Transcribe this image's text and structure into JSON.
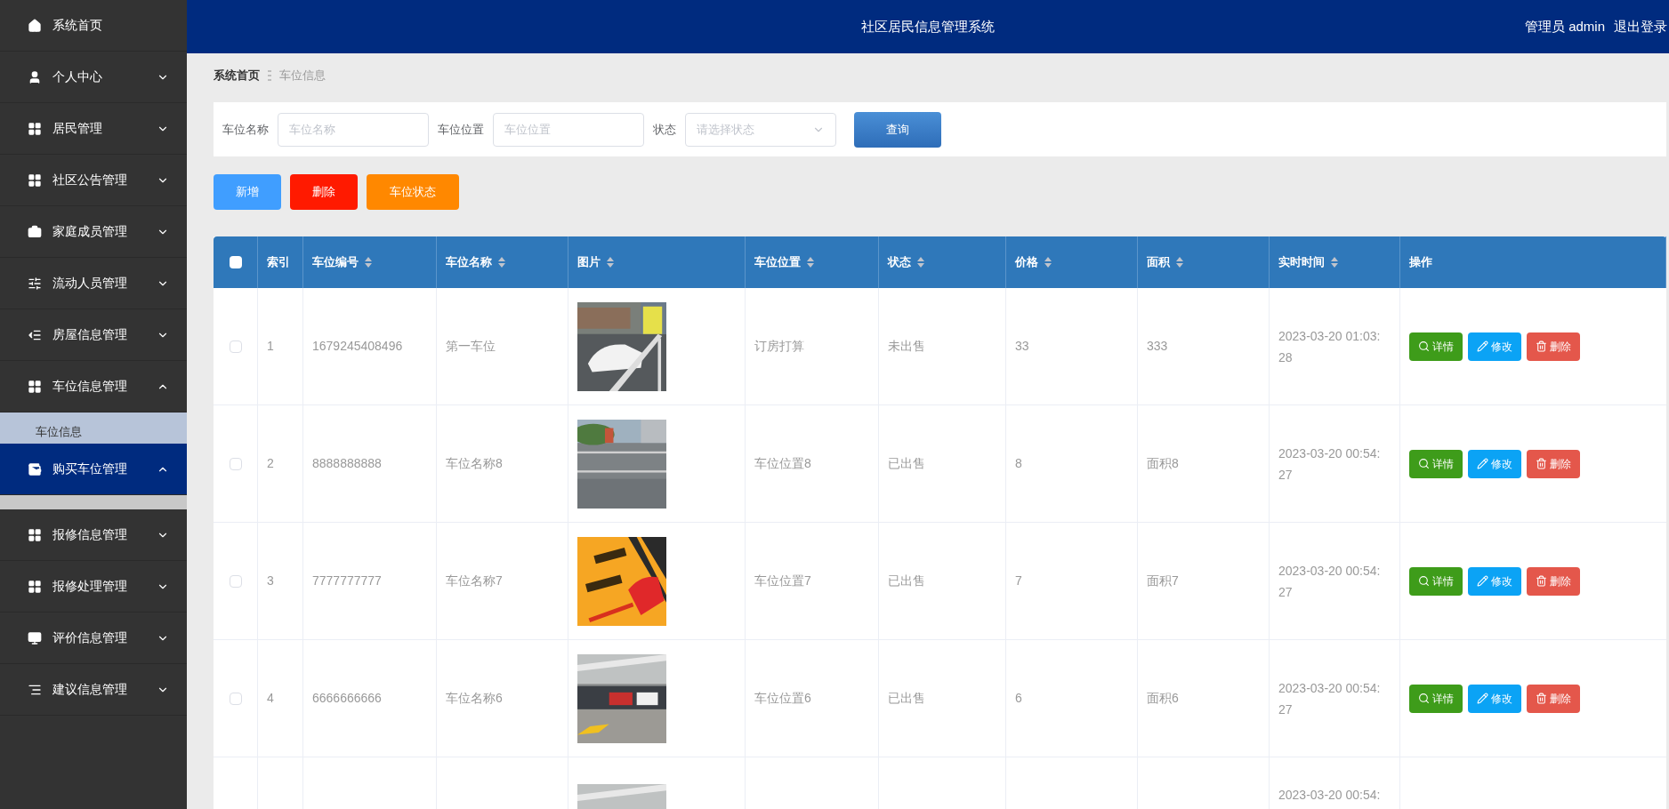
{
  "header": {
    "title": "社区居民信息管理系统",
    "user": "管理员 admin",
    "logout": "退出登录"
  },
  "sidebar": {
    "items": [
      {
        "label": "系统首页",
        "expandable": false,
        "selected": false
      },
      {
        "label": "个人中心",
        "expandable": true,
        "expanded": false,
        "selected": false
      },
      {
        "label": "居民管理",
        "expandable": true,
        "expanded": false,
        "selected": false
      },
      {
        "label": "社区公告管理",
        "expandable": true,
        "expanded": false,
        "selected": false
      },
      {
        "label": "家庭成员管理",
        "expandable": true,
        "expanded": false,
        "selected": false
      },
      {
        "label": "流动人员管理",
        "expandable": true,
        "expanded": false,
        "selected": false
      },
      {
        "label": "房屋信息管理",
        "expandable": true,
        "expanded": false,
        "selected": false
      },
      {
        "label": "车位信息管理",
        "expandable": true,
        "expanded": true,
        "selected": false,
        "children": [
          {
            "label": "车位信息"
          }
        ]
      },
      {
        "label": "购买车位管理",
        "expandable": true,
        "expanded": true,
        "selected": true
      },
      {
        "label": "报修信息管理",
        "expandable": true,
        "expanded": false,
        "selected": false
      },
      {
        "label": "报修处理管理",
        "expandable": true,
        "expanded": false,
        "selected": false
      },
      {
        "label": "评价信息管理",
        "expandable": true,
        "expanded": false,
        "selected": false
      },
      {
        "label": "建议信息管理",
        "expandable": true,
        "expanded": false,
        "selected": false
      }
    ]
  },
  "breadcrumb": [
    "系统首页",
    "车位信息"
  ],
  "search": {
    "fields": [
      {
        "label": "车位名称",
        "placeholder": "车位名称",
        "kind": "input"
      },
      {
        "label": "车位位置",
        "placeholder": "车位位置",
        "kind": "input"
      },
      {
        "label": "状态",
        "placeholder": "请选择状态",
        "kind": "select"
      }
    ],
    "button": "查询"
  },
  "toolbar": [
    {
      "label": "新增",
      "kind": "add"
    },
    {
      "label": "删除",
      "kind": "delete"
    },
    {
      "label": "车位状态",
      "kind": "status"
    }
  ],
  "table": {
    "all_checked": false,
    "columns": [
      {
        "label": "索引",
        "sortable": false
      },
      {
        "label": "车位编号",
        "sortable": true
      },
      {
        "label": "车位名称",
        "sortable": true
      },
      {
        "label": "图片",
        "sortable": true
      },
      {
        "label": "车位位置",
        "sortable": true
      },
      {
        "label": "状态",
        "sortable": true
      },
      {
        "label": "价格",
        "sortable": true
      },
      {
        "label": "面积",
        "sortable": true
      },
      {
        "label": "实时时间",
        "sortable": true
      },
      {
        "label": "操作",
        "sortable": false
      }
    ],
    "rows": [
      {
        "checked": false,
        "index": "1",
        "number": "1679245408496",
        "name": "第一车位",
        "location": "订房打算",
        "status": "未出售",
        "price": "33",
        "area": "333",
        "time": "2023-03-20 01:03:28",
        "actions": [
          {
            "label": "详情",
            "kind": "detail"
          },
          {
            "label": "修改",
            "kind": "edit"
          },
          {
            "label": "删除",
            "kind": "delete"
          }
        ]
      },
      {
        "checked": false,
        "index": "2",
        "number": "8888888888",
        "name": "车位名称8",
        "location": "车位位置8",
        "status": "已出售",
        "price": "8",
        "area": "面积8",
        "time": "2023-03-20 00:54:27",
        "actions": [
          {
            "label": "详情",
            "kind": "detail"
          },
          {
            "label": "修改",
            "kind": "edit"
          },
          {
            "label": "删除",
            "kind": "delete"
          }
        ]
      },
      {
        "checked": false,
        "index": "3",
        "number": "7777777777",
        "name": "车位名称7",
        "location": "车位位置7",
        "status": "已出售",
        "price": "7",
        "area": "面积7",
        "time": "2023-03-20 00:54:27",
        "actions": [
          {
            "label": "详情",
            "kind": "detail"
          },
          {
            "label": "修改",
            "kind": "edit"
          },
          {
            "label": "删除",
            "kind": "delete"
          }
        ]
      },
      {
        "checked": false,
        "index": "4",
        "number": "6666666666",
        "name": "车位名称6",
        "location": "车位位置6",
        "status": "已出售",
        "price": "6",
        "area": "面积6",
        "time": "2023-03-20 00:54:27",
        "actions": [
          {
            "label": "详情",
            "kind": "detail"
          },
          {
            "label": "修改",
            "kind": "edit"
          },
          {
            "label": "删除",
            "kind": "delete"
          }
        ]
      },
      {
        "time": "2023-03-20 00:54:"
      }
    ]
  }
}
